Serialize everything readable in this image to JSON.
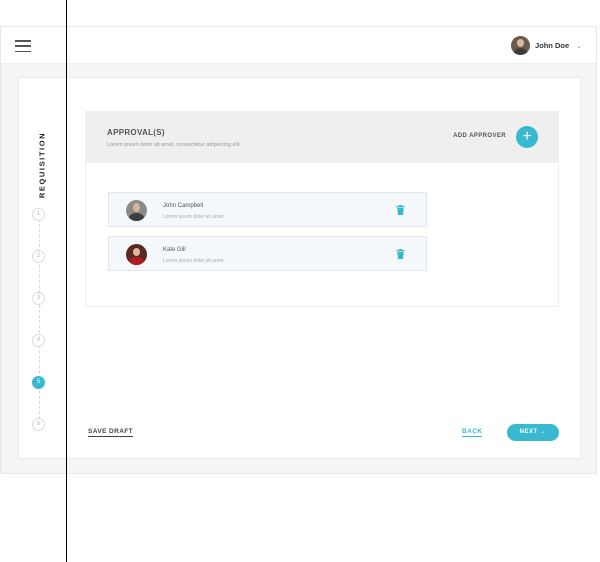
{
  "header": {
    "user_name": "John Doe",
    "chevron": "⌄",
    "menu_icon": "hamburger-icon"
  },
  "stepper": {
    "title": "REQUISITION",
    "steps": [
      "1",
      "2",
      "3",
      "4",
      "5",
      "6"
    ],
    "active_step": "5"
  },
  "approvals": {
    "title": "APPROVAL(S)",
    "subtitle": "Lorem ipsum dolor sit amet, consectetur adipiscing elit.",
    "add_label": "ADD APPROVER",
    "add_icon": "+",
    "approvers": [
      {
        "name": "John Campbell",
        "description": "Lorem ipsum doler sit amet."
      },
      {
        "name": "Kate Gill",
        "description": "Lorem ipsum doler sit amet."
      }
    ]
  },
  "footer": {
    "save_draft": "SAVE DRAFT",
    "back": "BACK",
    "next": "NEXT →"
  },
  "colors": {
    "accent": "#39b9d0",
    "header_band": "#efefef",
    "row_bg": "#f4f8fa"
  }
}
